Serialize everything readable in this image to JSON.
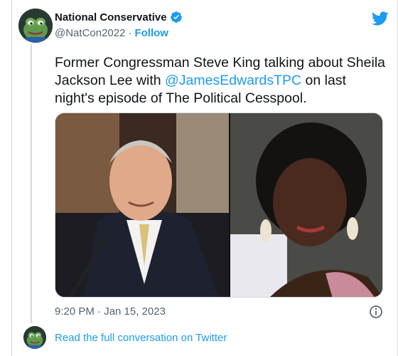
{
  "tweet": {
    "display_name": "National Conservative",
    "handle": "@NatCon2022",
    "separator": "·",
    "follow_label": "Follow",
    "text_before": "Former Congressman Steve King talking about Sheila Jackson Lee with ",
    "mention": "@JamesEdwardsTPC",
    "text_after": " on last night's episode of The Political Cesspool.",
    "timestamp": "9:20 PM · Jan 15, 2023"
  },
  "footer": {
    "read_more": "Read the full conversation on Twitter"
  },
  "icons": {
    "verified": "verified-badge-icon",
    "twitter": "twitter-bird-icon",
    "info": "info-icon"
  },
  "colors": {
    "accent": "#1d9bf0",
    "text": "#0f1419",
    "muted": "#536471",
    "border": "#cfd9de"
  }
}
